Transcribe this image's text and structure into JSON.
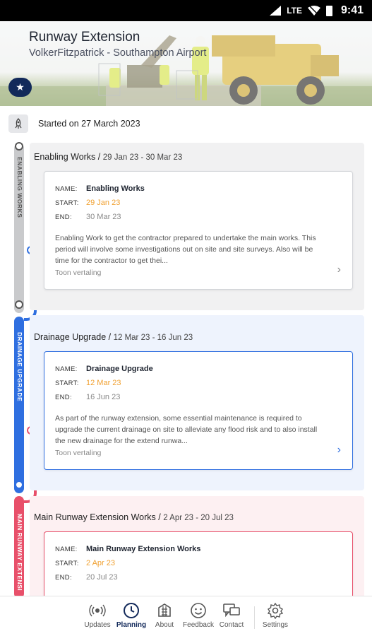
{
  "status_bar": {
    "network": "LTE",
    "time": "9:41"
  },
  "header": {
    "title": "Runway Extension",
    "subtitle": "VolkerFitzpatrick - Southampton Airport",
    "favorite_icon": "star-icon"
  },
  "start": {
    "icon": "rocket-icon",
    "text": "Started on 27 March 2023"
  },
  "phases": [
    {
      "side_label": "ENABLING WORKS",
      "color": "#c9cacc",
      "title": "Enabling Works /",
      "dates": "29 Jan 23 - 30 Mar 23",
      "card": {
        "name_label": "NAME:",
        "name": "Enabling Works",
        "start_label": "START:",
        "start": "29 Jan 23",
        "end_label": "END:",
        "end": "30 Mar 23",
        "description": "Enabling Work to get the contractor prepared to undertake the main works. This period will involve some investigations out on site and site surveys. Also will be time for the contractor to get thei...",
        "more": "Toon vertaling"
      }
    },
    {
      "side_label": "DRAINAGE UPGRADE",
      "color": "#2f6fe0",
      "title": "Drainage Upgrade /",
      "dates": "12 Mar 23 - 16 Jun 23",
      "card": {
        "name_label": "NAME:",
        "name": "Drainage Upgrade",
        "start_label": "START:",
        "start": "12 Mar 23",
        "end_label": "END:",
        "end": "16 Jun 23",
        "description": "As part of the runway extension, some essential maintenance is required to upgrade the current drainage on site to alleviate any flood risk and to also install the new drainage for the extend runwa...",
        "more": "Toon vertaling"
      }
    },
    {
      "side_label": "MAIN RUNWAY EXTENSI",
      "color": "#e8506a",
      "title": "Main Runway Extension Works /",
      "dates": "2 Apr 23 - 20 Jul 23",
      "card": {
        "name_label": "NAME:",
        "name": "Main Runway Extension Works",
        "start_label": "START:",
        "start": "2 Apr 23",
        "end_label": "END:",
        "end": "20 Jul 23"
      }
    }
  ],
  "bottom_nav": [
    {
      "label": "Updates",
      "icon": "broadcast-icon"
    },
    {
      "label": "Planning",
      "icon": "clock-icon",
      "active": true
    },
    {
      "label": "About",
      "icon": "building-icon"
    },
    {
      "label": "Feedback",
      "icon": "smiley-icon"
    },
    {
      "label": "Contact",
      "icon": "chat-icon"
    },
    {
      "label": "Settings",
      "icon": "gear-icon"
    }
  ],
  "colors": {
    "primary_navy": "#12295a",
    "start_date_orange": "#f0a030",
    "phase_grey": "#c9cacc",
    "phase_blue": "#2f6fe0",
    "phase_pink": "#e8506a"
  }
}
